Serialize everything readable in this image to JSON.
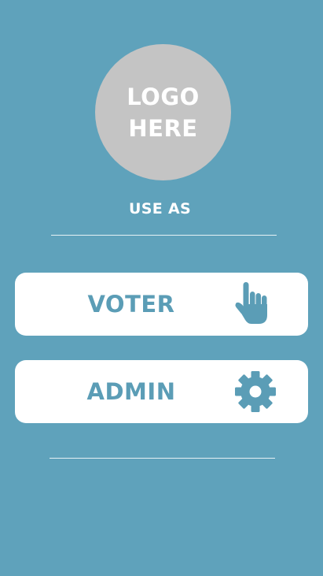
{
  "logo": {
    "line1": "LOGO",
    "line2": "HERE"
  },
  "prompt": {
    "label": "USE AS"
  },
  "roles": [
    {
      "label": "VOTER",
      "icon": "pointing-hand-icon"
    },
    {
      "label": "ADMIN",
      "icon": "gear-icon"
    }
  ],
  "colors": {
    "background": "#5fa2bb",
    "accent": "#5b9db6",
    "logo_placeholder": "#c4c4c4",
    "button": "#ffffff"
  }
}
